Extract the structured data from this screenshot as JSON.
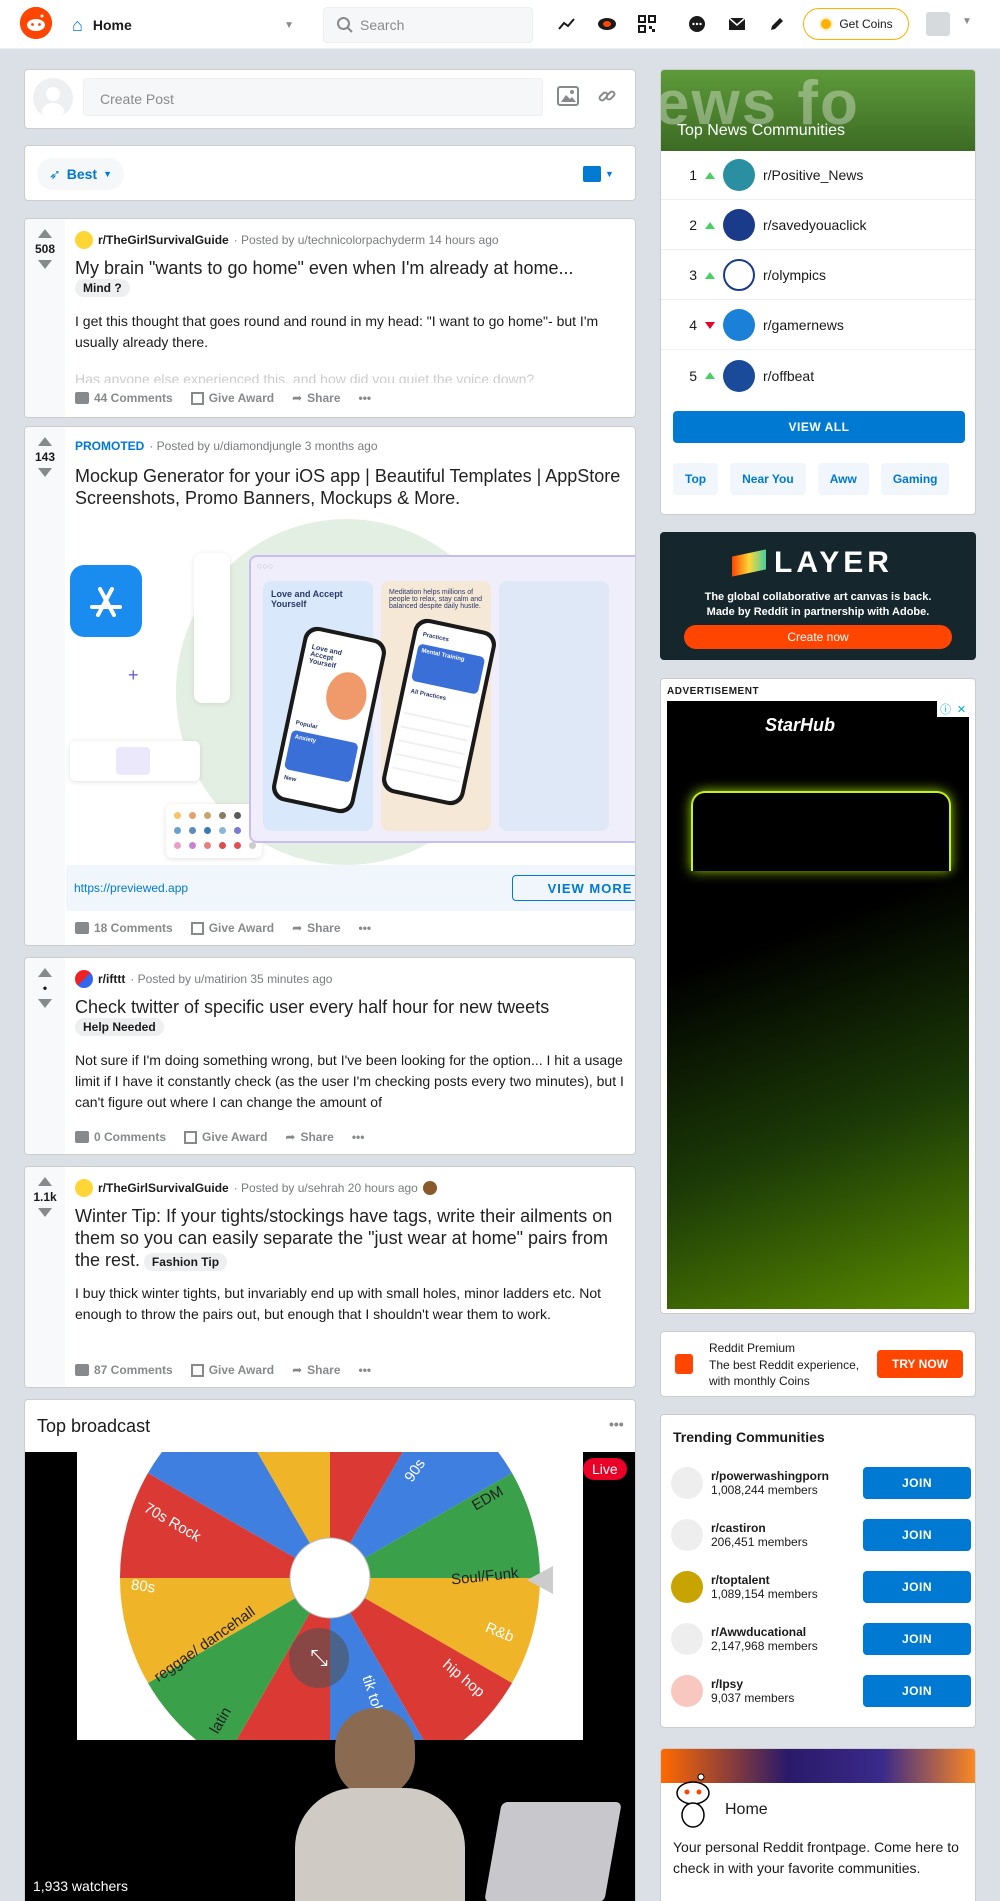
{
  "header": {
    "home_label": "Home",
    "search_placeholder": "Search",
    "coins_label": "Get Coins"
  },
  "create_post": {
    "placeholder": "Create Post"
  },
  "sort": {
    "label": "Best"
  },
  "posts": [
    {
      "votes": "508",
      "subreddit": "r/TheGirlSurvivalGuide",
      "posted_by": "· Posted by u/technicolorpachyderm 14 hours ago",
      "title": "My brain \"wants to go home\" even when I'm already at home...",
      "flair": "Mind ?",
      "body": "I get this thought that goes round and round in my head: \"I want to go home\"- but I'm usually already there.",
      "body_faded": "Has anyone else experienced this, and how did you quiet the voice down?",
      "comments": "44 Comments",
      "award": "Give Award",
      "share": "Share"
    },
    {
      "votes": "143",
      "promoted": "PROMOTED",
      "posted_by": "· Posted by u/diamondjungle 3 months ago",
      "title": "Mockup Generator for your iOS app | Beautiful Templates | AppStore Screenshots, Promo Banners, Mockups & More.",
      "link": "https://previewed.app",
      "view_more": "VIEW MORE",
      "ad_card1": "Love and Accept Yourself",
      "ad_card2": "Meditation helps millions of people to relax, stay calm and balanced despite daily hustle.",
      "phone1_title": "Love and Accept Yourself",
      "phone1_popular": "Popular",
      "phone1_anxiety": "Anxiety",
      "phone1_new": "New",
      "phone2_title": "Mental Training",
      "phone2_practices": "Practices",
      "phone2_all": "All Practices",
      "comments": "18 Comments",
      "award": "Give Award",
      "share": "Share"
    },
    {
      "votes": "•",
      "subreddit": "r/ifttt",
      "posted_by": "· Posted by u/matirion 35 minutes ago",
      "title": "Check twitter of specific user every half hour for new tweets",
      "flair": "Help Needed",
      "body": "Not sure if I'm doing something wrong, but I've been looking for the option... I hit a usage limit if I have it constantly check (as the user I'm checking posts every two minutes), but I can't figure out where I can change the amount of",
      "comments": "0 Comments",
      "award": "Give Award",
      "share": "Share"
    },
    {
      "votes": "1.1k",
      "subreddit": "r/TheGirlSurvivalGuide",
      "posted_by": "· Posted by u/sehrah 20 hours ago",
      "title": "Winter Tip: If your tights/stockings have tags, write their ailments on them so you can easily separate the \"just wear at home\" pairs from the rest.",
      "flair": "Fashion Tip",
      "body": "I buy thick winter tights, but invariably end up with small holes, minor ladders etc. Not enough to throw the pairs out, but enough that I shouldn't wear them to work.",
      "comments": "87 Comments",
      "award": "Give Award",
      "share": "Share"
    }
  ],
  "broadcast": {
    "title": "Top broadcast",
    "live": "Live",
    "watchers": "1,933 watchers",
    "wheel_labels": [
      "70s Rock",
      "80s",
      "reggae/ dancehall",
      "latin",
      "tik tok",
      "hip hop",
      "R&b",
      "Soul/Funk",
      "EDM",
      "90s"
    ]
  },
  "top_news": {
    "banner_text": "ews fo",
    "title": "Top News Communities",
    "items": [
      {
        "rank": "1",
        "name": "r/Positive_News",
        "trend": "up"
      },
      {
        "rank": "2",
        "name": "r/savedyouaclick",
        "trend": "up"
      },
      {
        "rank": "3",
        "name": "r/olympics",
        "trend": "up"
      },
      {
        "rank": "4",
        "name": "r/gamernews",
        "trend": "down"
      },
      {
        "rank": "5",
        "name": "r/offbeat",
        "trend": "up"
      }
    ],
    "view_all": "VIEW ALL",
    "tags": [
      "Top",
      "Near You",
      "Aww",
      "Gaming"
    ]
  },
  "layer_ad": {
    "brand": "LAYER",
    "text": "The global collaborative art canvas is back. Made by Reddit in partnership with Adobe.",
    "button": "Create now"
  },
  "advertisement": {
    "label": "ADVERTISEMENT",
    "brand": "StarHub"
  },
  "premium": {
    "title": "Reddit Premium",
    "text": "The best Reddit experience, with monthly Coins",
    "button": "TRY NOW"
  },
  "trending": {
    "title": "Trending Communities",
    "join": "JOIN",
    "items": [
      {
        "name": "r/powerwashingporn",
        "members": "1,008,244 members"
      },
      {
        "name": "r/castiron",
        "members": "206,451 members"
      },
      {
        "name": "r/toptalent",
        "members": "1,089,154 members"
      },
      {
        "name": "r/Awwducational",
        "members": "2,147,968 members"
      },
      {
        "name": "r/Ipsy",
        "members": "9,037 members"
      }
    ]
  },
  "home_card": {
    "title": "Home",
    "text": "Your personal Reddit frontpage. Come here to check in with your favorite communities."
  },
  "colors": {
    "brand": "#ff4500",
    "blue": "#0079d3",
    "up": "#46d160",
    "down": "#ea0027"
  }
}
